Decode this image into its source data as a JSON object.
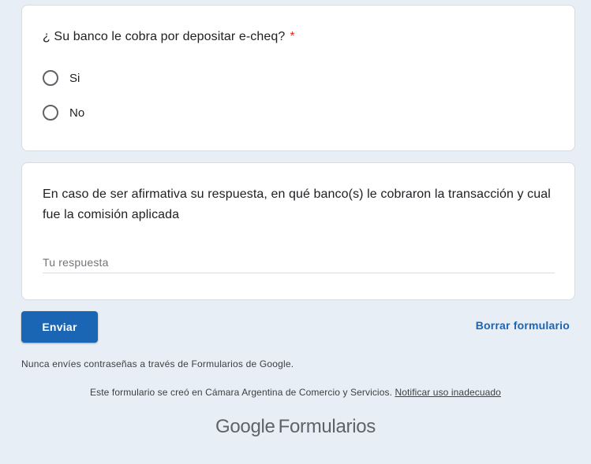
{
  "question1": {
    "title": "¿ Su banco le cobra por depositar e-cheq?",
    "required_mark": "*",
    "options": [
      {
        "label": "Si"
      },
      {
        "label": "No"
      }
    ]
  },
  "question2": {
    "title": "En caso de ser afirmativa su respuesta, en qué banco(s) le cobraron la transacción y cual fue la comisión aplicada",
    "placeholder": "Tu respuesta",
    "value": ""
  },
  "actions": {
    "submit_label": "Enviar",
    "clear_label": "Borrar formulario"
  },
  "footer": {
    "warning": "Nunca envíes contraseñas a través de Formularios de Google.",
    "created_in": "Este formulario se creó en Cámara Argentina de Comercio y Servicios.",
    "report_link": "Notificar uso inadecuado",
    "brand_google": "Google",
    "brand_forms": "Formularios"
  },
  "colors": {
    "background": "#e8eef5",
    "accent": "#1a65b4",
    "required": "#d93025"
  }
}
